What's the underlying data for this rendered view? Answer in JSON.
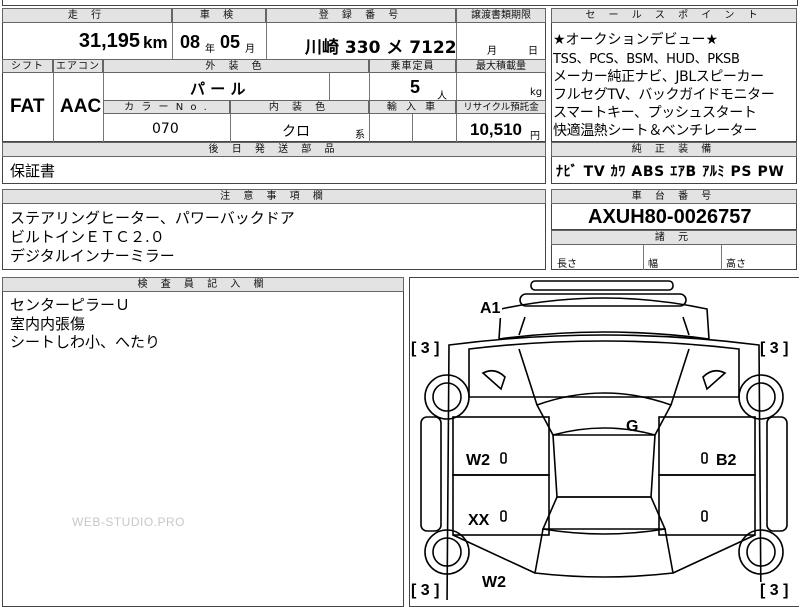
{
  "top_row": {
    "mileage_hdr": "走 行",
    "shaken_hdr": "車 検",
    "reg_hdr": "登 録 番 号",
    "transfer_hdr": "譲渡書類期限",
    "mileage": "31,195",
    "mileage_unit": "km",
    "shaken_year": "08",
    "year_unit": "年",
    "shaken_month": "05",
    "month_unit": "月",
    "reg_number": "川崎  330 メ 7122",
    "transfer_month_unit": "月",
    "transfer_day_unit": "日"
  },
  "row2": {
    "shift_hdr": "シフト",
    "ac_hdr": "エアコン",
    "ext_color_hdr": "外 装 色",
    "capacity_hdr": "乗車定員",
    "max_load_hdr": "最大積載量",
    "shift": "FAT",
    "ac": "AAC",
    "ext_color": "パ ー ル",
    "capacity": "5",
    "capacity_unit": "人",
    "max_load_unit": "kg",
    "color_no_hdr": "カ ラ ー  N o .",
    "int_color_hdr": "内 装 色",
    "import_hdr": "輸 入 車",
    "recycle_hdr": "リサイクル預託金",
    "color_no": "070",
    "int_color": "クロ",
    "int_suffix": "系",
    "recycle": "10,510",
    "recycle_unit": "円"
  },
  "later_parts": {
    "hdr": "後 日 発 送 部 品",
    "value": "保証書"
  },
  "notes": {
    "hdr": "注 意 事 項 欄",
    "lines": [
      "ステアリングヒーター、パワーバックドア",
      "ビルトインＥＴＣ２.０",
      "デジタルインナーミラー"
    ]
  },
  "inspector": {
    "hdr": "検 査 員 記 入 欄",
    "lines": [
      "センターピラーＵ",
      "室内内張傷",
      "シートしわ小、へたり"
    ]
  },
  "sales_points": {
    "hdr": "セ ー ル ス ポ イ ン ト",
    "lines": [
      "★オークションデビュー★",
      "TSS、PCS、BSM、HUD、PKSB",
      "メーカー純正ナビ、JBLスピーカー",
      "フルセグTV、バックガイドモニター",
      "スマートキー、プッシュスタート",
      "快適温熱シート＆ベンチレーター"
    ]
  },
  "equipment": {
    "hdr": "純 正 装 備",
    "items": "ﾅﾋﾞ  TV  ｶﾜ  ABS  ｴｱB  ｱﾙﾐ  PS  PW"
  },
  "chassis": {
    "hdr": "車 台 番 号",
    "value": "AXUH80-0026757"
  },
  "dimensions": {
    "hdr": "諸 元",
    "length": "長さ",
    "width": "幅",
    "height": "高さ"
  },
  "diagram": {
    "marks": {
      "a1": "A1",
      "g": "G",
      "w2_left": "W2",
      "b2": "B2",
      "xx": "XX",
      "w2_bottom": "W2",
      "tire_tl": "[ 3 ]",
      "tire_tr": "[ 3 ]",
      "tire_bl": "[ 3 ]",
      "tire_br": "[ 3 ]"
    }
  },
  "watermark": "WEB-STUDIO.PRO"
}
